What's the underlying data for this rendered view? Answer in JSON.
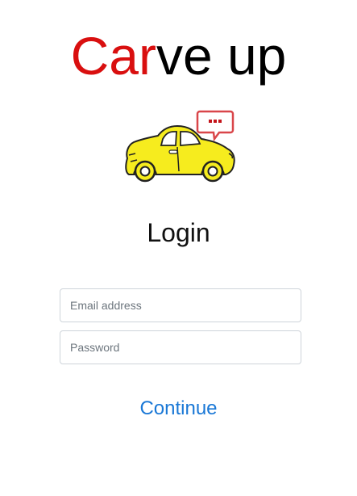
{
  "brand": {
    "title_accent": "Car",
    "title_rest": "ve up",
    "accent_color": "#d90f0f",
    "logo_icon": "car-with-chat-bubble-icon"
  },
  "login": {
    "heading": "Login",
    "email_placeholder": "Email address",
    "password_placeholder": "Password",
    "continue_label": "Continue",
    "link_color": "#1a78d6"
  }
}
